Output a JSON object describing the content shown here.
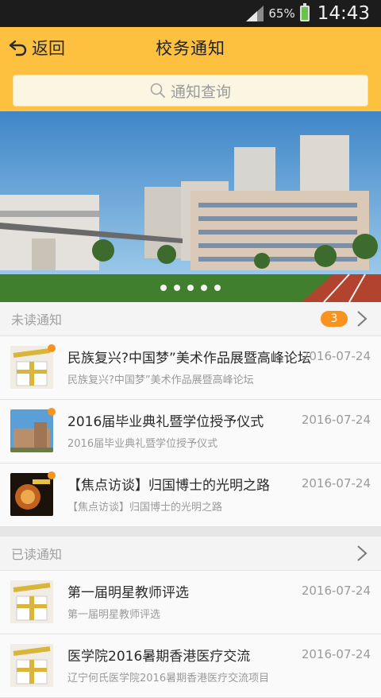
{
  "status_bar": {
    "battery": "65%",
    "time": "14:43"
  },
  "header": {
    "back_label": "返回",
    "title": "校务通知"
  },
  "search": {
    "placeholder": "通知查询"
  },
  "unread": {
    "label": "未读通知",
    "count": "3",
    "items": [
      {
        "title": "民族复兴?中国梦”美术作品展暨高峰论坛",
        "subtitle": "民族复兴?中国梦”美术作品展暨高峰论坛",
        "date": "2016-07-24"
      },
      {
        "title": "2016届毕业典礼暨学位授予仪式",
        "subtitle": "2016届毕业典礼暨学位授予仪式",
        "date": "2016-07-24"
      },
      {
        "title": "【焦点访谈】归国博士的光明之路",
        "subtitle": "【焦点访谈】归国博士的光明之路",
        "date": "2016-07-24"
      }
    ]
  },
  "read": {
    "label": "已读通知",
    "items": [
      {
        "title": "第一届明星教师评选",
        "subtitle": "第一届明星教师评选",
        "date": "2016-07-24"
      },
      {
        "title": "医学院2016暑期香港医疗交流",
        "subtitle": "辽宁何氏医学院2016暑期香港医疗交流项目",
        "date": "2016-07-24"
      }
    ]
  },
  "colors": {
    "accent": "#fdc03f",
    "badge": "#f7931e"
  },
  "icons": [
    "signal-icon",
    "battery-icon",
    "back-arrow-icon",
    "search-icon",
    "chevron-right-icon"
  ]
}
